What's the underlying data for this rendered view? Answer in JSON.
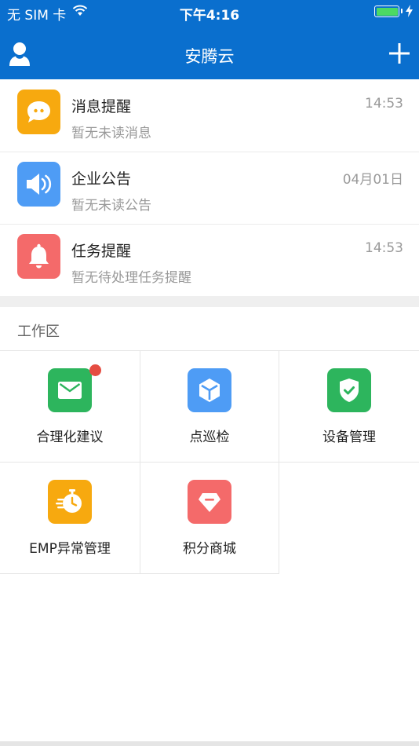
{
  "status_bar": {
    "carrier": "无 SIM 卡",
    "time": "下午4:16",
    "battery_level": 1.0
  },
  "nav": {
    "title": "安腾云",
    "left_icon": "user-icon",
    "right_icon": "plus-icon"
  },
  "messages": [
    {
      "title": "消息提醒",
      "subtitle": "暂无未读消息",
      "time": "14:53",
      "icon": "chat-bubble-icon",
      "color": "#f7a90f"
    },
    {
      "title": "企业公告",
      "subtitle": "暂无未读公告",
      "time": "04月01日",
      "icon": "speaker-icon",
      "color": "#4e9cf5"
    },
    {
      "title": "任务提醒",
      "subtitle": "暂无待处理任务提醒",
      "time": "14:53",
      "icon": "bell-icon",
      "color": "#f46a6a"
    }
  ],
  "workspace": {
    "title": "工作区",
    "items": [
      {
        "label": "合理化建议",
        "icon": "mail-icon",
        "color": "#2db55d",
        "badge": true
      },
      {
        "label": "点巡检",
        "icon": "cube-icon",
        "color": "#4e9cf5",
        "badge": false
      },
      {
        "label": "设备管理",
        "icon": "shield-check-icon",
        "color": "#2db55d",
        "badge": false
      },
      {
        "label": "EMP异常管理",
        "icon": "stopwatch-icon",
        "color": "#f7a90f",
        "badge": false
      },
      {
        "label": "积分商城",
        "icon": "diamond-icon",
        "color": "#f46a6a",
        "badge": false
      }
    ]
  }
}
